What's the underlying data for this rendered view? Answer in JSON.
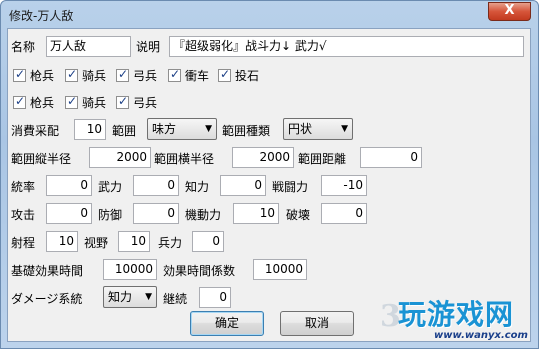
{
  "window": {
    "title": "修改-万人敌",
    "close_glyph": "X"
  },
  "name_row": {
    "name_label": "名称",
    "name_value": "万人敌",
    "desc_label": "说明",
    "desc_value": "『超级弱化』战斗力↓ 武力√"
  },
  "units_row1": [
    "枪兵",
    "骑兵",
    "弓兵",
    "衝车",
    "投石"
  ],
  "units_row2": [
    "枪兵",
    "骑兵",
    "弓兵"
  ],
  "cost": {
    "label": "消費采配",
    "value": "10"
  },
  "range": {
    "label": "範囲",
    "value": "味方"
  },
  "range_type": {
    "label": "範囲種類",
    "value": "円状"
  },
  "vert_radius": {
    "label": "範囲縦半径",
    "value": "2000"
  },
  "horiz_radius": {
    "label": "範囲横半径",
    "value": "2000"
  },
  "range_dist": {
    "label": "範囲距離",
    "value": "0"
  },
  "stats_row1": [
    {
      "label": "統率",
      "value": "0"
    },
    {
      "label": "武力",
      "value": "0"
    },
    {
      "label": "知力",
      "value": "0"
    },
    {
      "label": "戦闘力",
      "value": "-10"
    }
  ],
  "stats_row2": [
    {
      "label": "攻击",
      "value": "0"
    },
    {
      "label": "防御",
      "value": "0"
    },
    {
      "label": "機動力",
      "value": "10"
    },
    {
      "label": "破壊",
      "value": "0"
    }
  ],
  "stats_row3": [
    {
      "label": "射程",
      "value": "10"
    },
    {
      "label": "视野",
      "value": "10"
    },
    {
      "label": "兵力",
      "value": "0"
    }
  ],
  "base_time": {
    "label": "基礎効果時間",
    "value": "10000"
  },
  "time_coef": {
    "label": "効果時間係数",
    "value": "10000"
  },
  "damage": {
    "label": "ダメージ系統",
    "value": "知力"
  },
  "continue": {
    "label": "継続",
    "value": "0"
  },
  "buttons": {
    "ok": "确定",
    "cancel": "取消"
  },
  "watermark": {
    "number": "3",
    "text": "玩游戏网",
    "url": "www.wanyx.com"
  }
}
